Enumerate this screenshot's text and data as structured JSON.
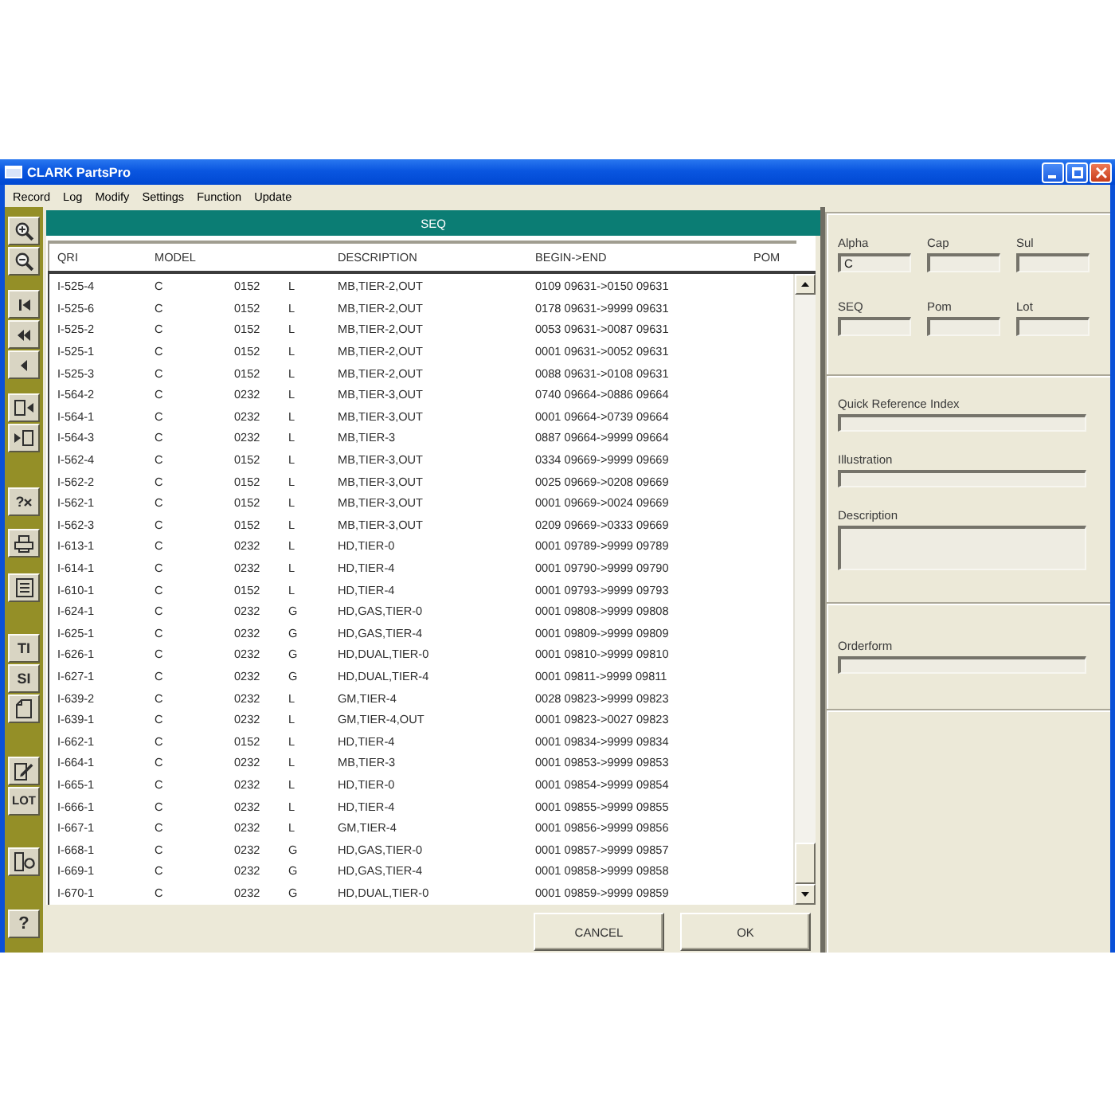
{
  "window": {
    "title": "CLARK PartsPro"
  },
  "menu": [
    "Record",
    "Log",
    "Modify",
    "Settings",
    "Function",
    "Update"
  ],
  "toolbar": {
    "groups": [
      [
        {
          "kind": "icon"
        },
        {
          "kind": "icon"
        }
      ],
      [
        {
          "kind": "icon"
        },
        {
          "kind": "icon"
        },
        {
          "kind": "icon"
        }
      ],
      [
        {
          "kind": "icon"
        },
        {
          "kind": "icon"
        }
      ],
      [
        {
          "kind": "help",
          "label": "?"
        }
      ],
      [
        {
          "kind": "icon"
        }
      ],
      [
        {
          "kind": "icon"
        }
      ],
      [
        {
          "kind": "text",
          "label": "TI"
        },
        {
          "kind": "text",
          "label": "SI"
        },
        {
          "kind": "icon"
        }
      ],
      [
        {
          "kind": "icon"
        },
        {
          "kind": "text",
          "label": "LOT"
        }
      ],
      [
        {
          "kind": "icon"
        }
      ],
      [
        {
          "kind": "text",
          "label": "?"
        }
      ]
    ]
  },
  "table": {
    "title": "SEQ",
    "columns": [
      "QRI",
      "MODEL",
      "",
      "",
      "DESCRIPTION",
      "BEGIN->END",
      "POM"
    ],
    "rows": [
      [
        "I-525-4",
        "C",
        "0152",
        "L",
        "MB,TIER-2,OUT",
        "0109 09631->0150 09631"
      ],
      [
        "I-525-6",
        "C",
        "0152",
        "L",
        "MB,TIER-2,OUT",
        "0178 09631->9999 09631"
      ],
      [
        "I-525-2",
        "C",
        "0152",
        "L",
        "MB,TIER-2,OUT",
        "0053 09631->0087 09631"
      ],
      [
        "I-525-1",
        "C",
        "0152",
        "L",
        "MB,TIER-2,OUT",
        "0001 09631->0052 09631"
      ],
      [
        "I-525-3",
        "C",
        "0152",
        "L",
        "MB,TIER-2,OUT",
        "0088 09631->0108 09631"
      ],
      [
        "I-564-2",
        "C",
        "0232",
        "L",
        "MB,TIER-3,OUT",
        "0740 09664->0886 09664"
      ],
      [
        "I-564-1",
        "C",
        "0232",
        "L",
        "MB,TIER-3,OUT",
        "0001 09664->0739 09664"
      ],
      [
        "I-564-3",
        "C",
        "0232",
        "L",
        "MB,TIER-3",
        "0887 09664->9999 09664"
      ],
      [
        "I-562-4",
        "C",
        "0152",
        "L",
        "MB,TIER-3,OUT",
        "0334 09669->9999 09669"
      ],
      [
        "I-562-2",
        "C",
        "0152",
        "L",
        "MB,TIER-3,OUT",
        "0025 09669->0208 09669"
      ],
      [
        "I-562-1",
        "C",
        "0152",
        "L",
        "MB,TIER-3,OUT",
        "0001 09669->0024 09669"
      ],
      [
        "I-562-3",
        "C",
        "0152",
        "L",
        "MB,TIER-3,OUT",
        "0209 09669->0333 09669"
      ],
      [
        "I-613-1",
        "C",
        "0232",
        "L",
        "HD,TIER-0",
        "0001 09789->9999 09789"
      ],
      [
        "I-614-1",
        "C",
        "0232",
        "L",
        "HD,TIER-4",
        "0001 09790->9999 09790"
      ],
      [
        "I-610-1",
        "C",
        "0152",
        "L",
        "HD,TIER-4",
        "0001 09793->9999 09793"
      ],
      [
        "I-624-1",
        "C",
        "0232",
        "G",
        "HD,GAS,TIER-0",
        "0001 09808->9999 09808"
      ],
      [
        "I-625-1",
        "C",
        "0232",
        "G",
        "HD,GAS,TIER-4",
        "0001 09809->9999 09809"
      ],
      [
        "I-626-1",
        "C",
        "0232",
        "G",
        "HD,DUAL,TIER-0",
        "0001 09810->9999 09810"
      ],
      [
        "I-627-1",
        "C",
        "0232",
        "G",
        "HD,DUAL,TIER-4",
        "0001 09811->9999 09811"
      ],
      [
        "I-639-2",
        "C",
        "0232",
        "L",
        "GM,TIER-4",
        "0028 09823->9999 09823"
      ],
      [
        "I-639-1",
        "C",
        "0232",
        "L",
        "GM,TIER-4,OUT",
        "0001 09823->0027 09823"
      ],
      [
        "I-662-1",
        "C",
        "0152",
        "L",
        "HD,TIER-4",
        "0001 09834->9999 09834"
      ],
      [
        "I-664-1",
        "C",
        "0232",
        "L",
        "MB,TIER-3",
        "0001 09853->9999 09853"
      ],
      [
        "I-665-1",
        "C",
        "0232",
        "L",
        "HD,TIER-0",
        "0001 09854->9999 09854"
      ],
      [
        "I-666-1",
        "C",
        "0232",
        "L",
        "HD,TIER-4",
        "0001 09855->9999 09855"
      ],
      [
        "I-667-1",
        "C",
        "0232",
        "L",
        "GM,TIER-4",
        "0001 09856->9999 09856"
      ],
      [
        "I-668-1",
        "C",
        "0232",
        "G",
        "HD,GAS,TIER-0",
        "0001 09857->9999 09857"
      ],
      [
        "I-669-1",
        "C",
        "0232",
        "G",
        "HD,GAS,TIER-4",
        "0001 09858->9999 09858"
      ],
      [
        "I-670-1",
        "C",
        "0232",
        "G",
        "HD,DUAL,TIER-0",
        "0001 09859->9999 09859"
      ]
    ]
  },
  "buttons": [
    "CANCEL",
    "OK"
  ],
  "details": {
    "sections": [
      {
        "kind": "grid",
        "fields": [
          {
            "label": "Alpha",
            "kind": "line",
            "value": "C"
          },
          {
            "label": "Cap",
            "kind": "line"
          },
          {
            "label": "Sul",
            "kind": "line"
          },
          {
            "label": "SEQ",
            "kind": "line"
          },
          {
            "label": "Pom",
            "kind": "line"
          },
          {
            "label": "Lot",
            "kind": "line"
          }
        ]
      },
      {
        "kind": "stack",
        "fields": [
          {
            "label": "Quick Reference Index",
            "kind": "line"
          },
          {
            "label": "Illustration",
            "kind": "line"
          },
          {
            "label": "Description",
            "kind": "multiline"
          }
        ]
      },
      {
        "kind": "stack",
        "fields": [
          {
            "label": "Orderform",
            "kind": "line"
          }
        ]
      }
    ]
  }
}
